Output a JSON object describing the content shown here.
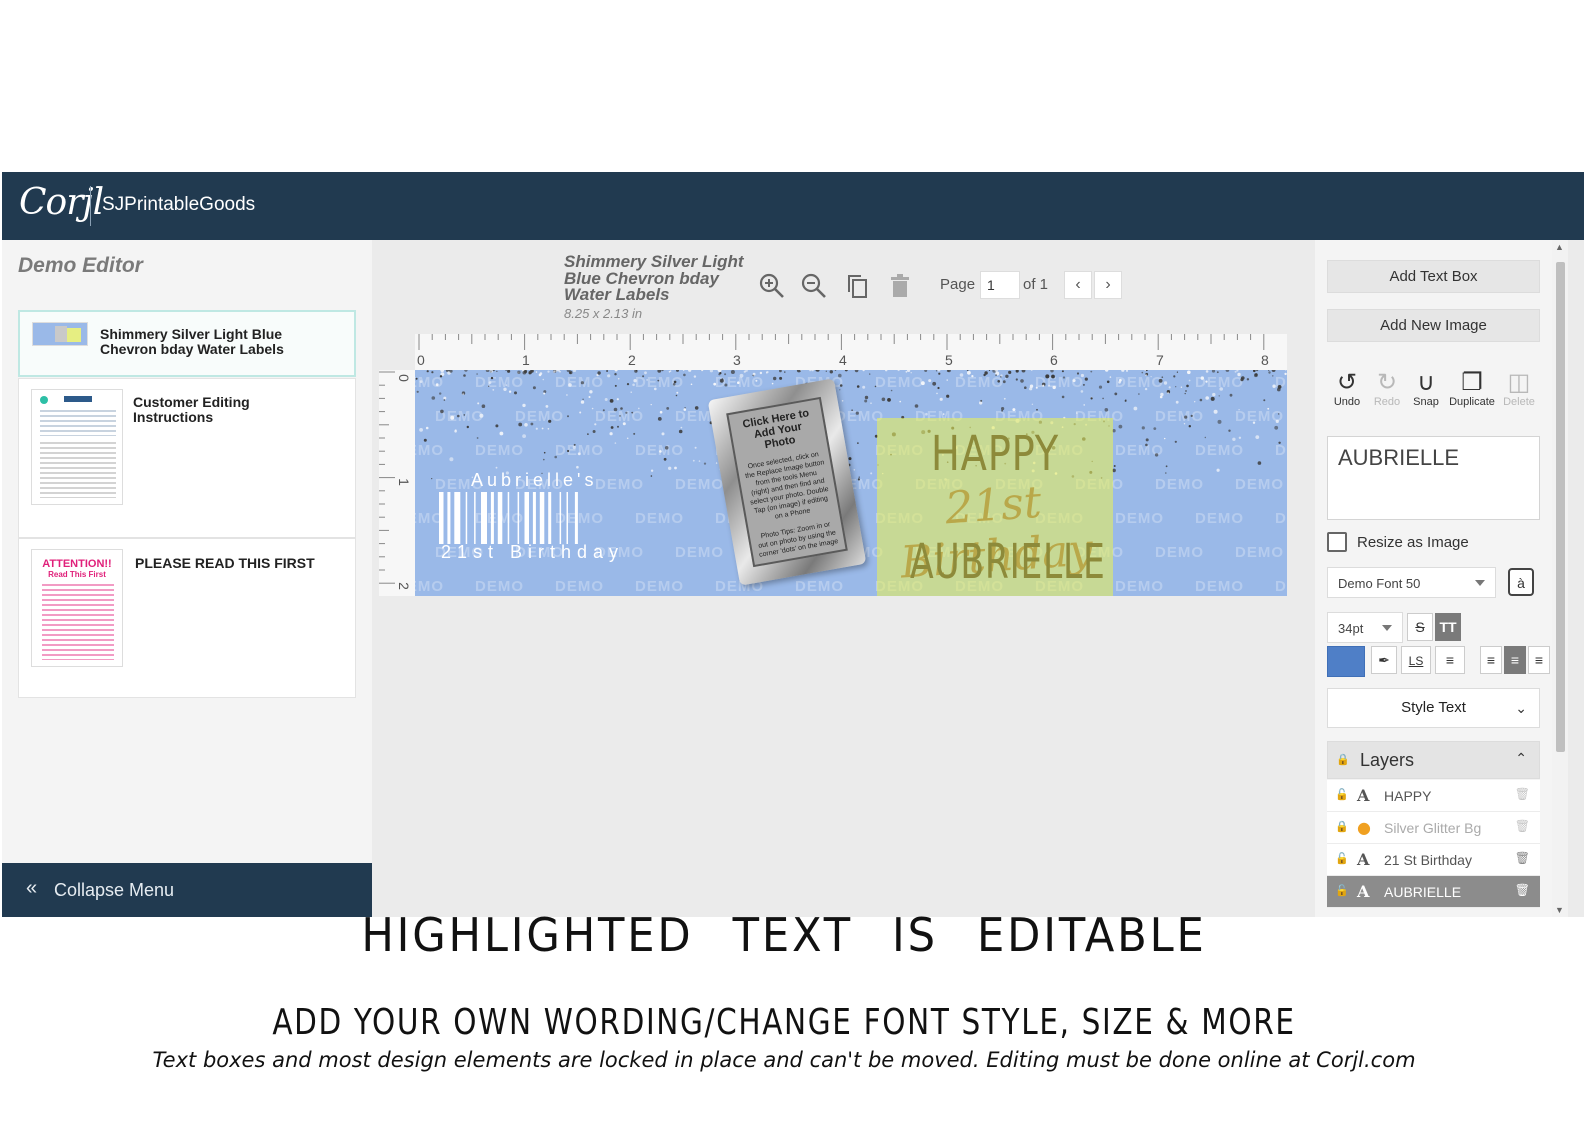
{
  "header": {
    "logo": "Corjl",
    "shop_name": "SJPrintableGoods"
  },
  "sidebar": {
    "title": "Demo Editor",
    "pages": [
      {
        "label": "Shimmery Silver Light Blue Chevron bday Water Labels"
      },
      {
        "label": "Customer Editing Instructions",
        "thumb_lines": [
          "Instructions"
        ]
      },
      {
        "label": "PLEASE READ THIS FIRST",
        "thumb_title": "ATTENTION!!",
        "thumb_subtitle": "Read This First"
      }
    ],
    "collapse_label": "Collapse Menu"
  },
  "document": {
    "title": "Shimmery Silver Light Blue Chevron bday Water Labels",
    "size": "8.25 x 2.13 in",
    "page_label": "Page",
    "page_value": "1",
    "page_of": "of 1"
  },
  "ruler": {
    "h_numbers": [
      "0",
      "1",
      "2",
      "3",
      "4",
      "5",
      "6",
      "7",
      "8"
    ],
    "v_numbers": [
      "0",
      "1",
      "2"
    ]
  },
  "design": {
    "watermark": "DEMO",
    "name_small": "Aubrielle's",
    "birthday_small": "21st Birthday",
    "frame_title": "Click Here to Add Your Photo",
    "frame_body": "Once selected, click on the Replace Image button from the tools Menu (right) and then find and select your photo. Double Tap (on image) if editing on a Phone",
    "frame_tip": "Photo Tips: Zoom in or out on photo by using the corner 'dots' on the image",
    "happy": "HAPPY",
    "birthday_script": "21st Birthday",
    "name_big": "AUBRIELLE",
    "bg_color": "#9ab9e8",
    "highlight_color": "#e8f05a"
  },
  "right_panel": {
    "add_text_box": "Add Text Box",
    "add_new_image": "Add New Image",
    "tools": [
      {
        "icon": "undo-icon",
        "label": "Undo",
        "enabled": true
      },
      {
        "icon": "redo-icon",
        "label": "Redo",
        "enabled": false
      },
      {
        "icon": "snap-icon",
        "label": "Snap",
        "enabled": true
      },
      {
        "icon": "duplicate-icon",
        "label": "Duplicate",
        "enabled": true
      },
      {
        "icon": "delete-icon",
        "label": "Delete",
        "enabled": false
      }
    ],
    "text_value": "AUBRIELLE",
    "resize_label": "Resize as Image",
    "font": "Demo Font 50",
    "font_size": "34pt",
    "color": "#4f7fc7",
    "style_text": "Style Text",
    "layers_title": "Layers",
    "layers": [
      {
        "type": "A",
        "name": "HAPPY"
      },
      {
        "type": "image",
        "name": "Silver Glitter Bg"
      },
      {
        "type": "A",
        "name": "21 St Birthday"
      },
      {
        "type": "A",
        "name": "AUBRIELLE"
      }
    ]
  },
  "captions": {
    "line1": "HIGHLIGHTED TEXT IS EDITABLE",
    "line2": "ADD YOUR OWN WORDING/CHANGE FONT STYLE, SIZE & MORE",
    "line3": "Text boxes and most design elements are locked in place and can't be moved. Editing must be done online at Corjl.com"
  }
}
